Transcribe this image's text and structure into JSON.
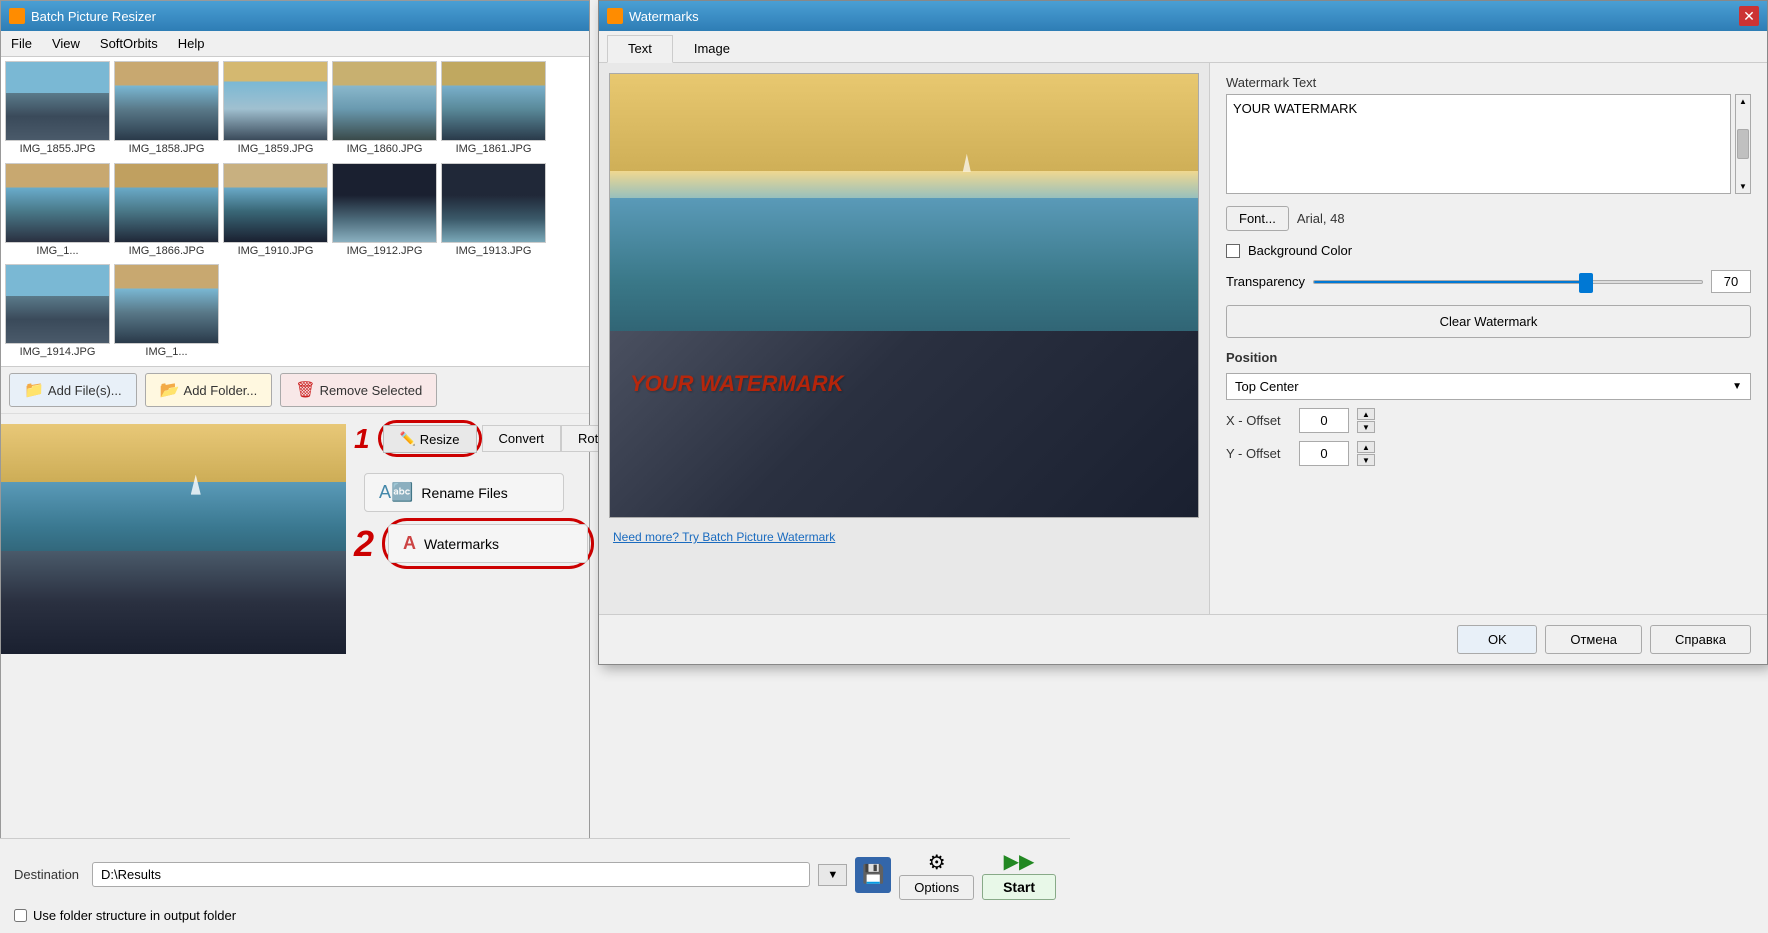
{
  "app": {
    "title": "Batch Picture Resizer",
    "menu": [
      "File",
      "View",
      "SoftOrbits",
      "Help"
    ],
    "thumbnails": [
      {
        "name": "IMG_1855.JPG",
        "class": "thumb-ocean-1"
      },
      {
        "name": "IMG_1858.JPG",
        "class": "thumb-ocean-2"
      },
      {
        "name": "IMG_1859.JPG",
        "class": "thumb-ocean-3"
      },
      {
        "name": "IMG_1860.JPG",
        "class": "thumb-ocean-4"
      },
      {
        "name": "IMG_1861.JPG",
        "class": "thumb-ocean-5"
      },
      {
        "name": "IMG_1...",
        "class": "thumb-ocean-6"
      },
      {
        "name": "IMG_1866.JPG",
        "class": "thumb-ocean-7"
      },
      {
        "name": "IMG_1910.JPG",
        "class": "thumb-ocean-8"
      },
      {
        "name": "IMG_1912.JPG",
        "class": "thumb-ocean-9"
      },
      {
        "name": "IMG_1913.JPG",
        "class": "thumb-ocean-10"
      },
      {
        "name": "IMG_1914.JPG",
        "class": "thumb-ocean-1"
      },
      {
        "name": "IMG_1...",
        "class": "thumb-ocean-2"
      }
    ],
    "action_bar": {
      "add_files": "Add File(s)...",
      "add_folder": "Add Folder...",
      "remove_selected": "Remove Selected"
    },
    "tabs": [
      "Resize",
      "Convert",
      "Rotate"
    ],
    "tool_buttons": [
      {
        "label": "Rename Files",
        "id": "rename"
      },
      {
        "label": "Watermarks",
        "id": "watermarks",
        "highlighted": true
      }
    ],
    "step1": "1",
    "step2": "2",
    "destination": {
      "label": "Destination",
      "value": "D:\\Results",
      "options_label": "Options",
      "start_label": "Start"
    },
    "use_folder_structure": "Use folder structure in output folder"
  },
  "dialog": {
    "title": "Watermarks",
    "close_label": "✕",
    "tabs": [
      "Text",
      "Image"
    ],
    "active_tab": "Text",
    "right_panel": {
      "watermark_text_label": "Watermark Text",
      "watermark_text_value": "YOUR WATERMARK",
      "font_btn_label": "Font...",
      "font_display": "Arial, 48",
      "background_color_label": "Background Color",
      "transparency_label": "Transparency",
      "transparency_value": "70",
      "clear_btn_label": "Clear Watermark",
      "position_label": "Position",
      "position_value": "Top Center",
      "x_offset_label": "X - Offset",
      "x_offset_value": "0",
      "y_offset_label": "Y - Offset",
      "y_offset_value": "0"
    },
    "preview": {
      "watermark_overlay": "YOUR WATERMARK",
      "link_text": "Need more? Try Batch Picture Watermark"
    },
    "buttons": {
      "ok": "OK",
      "cancel": "Отмена",
      "help": "Справка"
    }
  }
}
